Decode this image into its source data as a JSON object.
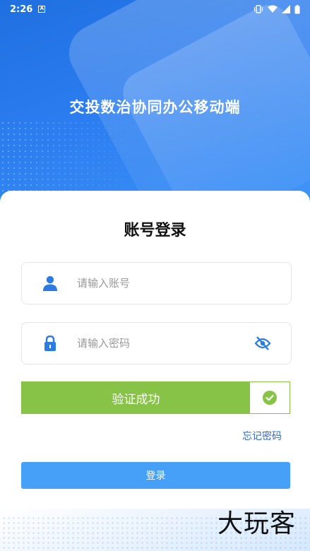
{
  "status_bar": {
    "time": "2:26",
    "notification_icon": "A",
    "icons": [
      "vibrate-icon",
      "wifi-icon",
      "signal-icon",
      "battery-icon"
    ]
  },
  "header": {
    "title": "交投数治协同办公移动端"
  },
  "login": {
    "title": "账号登录",
    "account_placeholder": "请输入账号",
    "password_placeholder": "请输入密码",
    "verify_text": "验证成功",
    "forgot_password": "忘记密码",
    "login_button": "登录"
  },
  "colors": {
    "primary_blue": "#2b7df0",
    "verify_green": "#86c346",
    "link_blue": "#2a6bd9",
    "button_blue": "#47a0f7"
  },
  "watermark": "大玩客"
}
